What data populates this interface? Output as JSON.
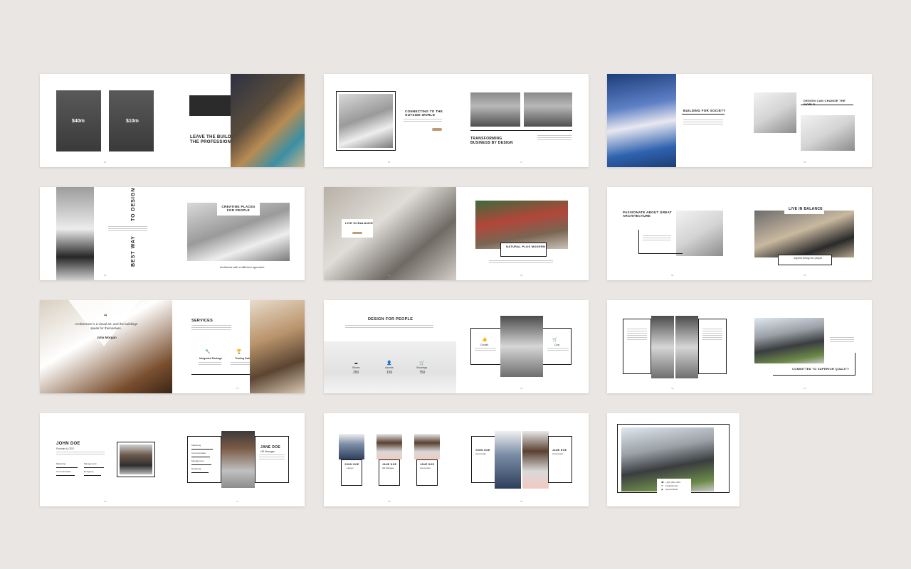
{
  "spreads": [
    {
      "photo_labels": [
        "$40m",
        "$10m"
      ],
      "title": "LEAVE THE BUILDING TO THE PROFESSIONALS."
    },
    {
      "title_left": "CONNECTING TO THE OUTSIDE WORLD",
      "title_right": "TRANSFORMING BUSINESS BY DESIGN"
    },
    {
      "title_left": "BUILDING FOR SOCIETY",
      "title_right": "DESIGN CAN CHANGE THE WORLD"
    },
    {
      "vertical_text_1": "TO DESIGN",
      "vertical_text_2": "BEST WAY",
      "title_right": "CREATING PLACES FOR PEOPLE",
      "caption_right": "Architects with a different approach."
    },
    {
      "title_left": "LIVE IN BALANCE",
      "title_right": "NATURAL PLUS MODERN"
    },
    {
      "title_left": "PASSIONATE ABOUT GREAT ARCHITECTURE",
      "title_right": "LIVE IN BALANCE",
      "caption_right": "Inspired design for people"
    },
    {
      "quote_mark": "“",
      "quote": "Architecture is a visual art, and the buildings speak for themselves.",
      "author": "Julia Morgan",
      "title_right": "SERVICES",
      "service_1": "Integrated Package",
      "service_2": "Trading Gate"
    },
    {
      "title": "DESIGN FOR PEOPLE",
      "stat_labels": [
        "Shows",
        "Awards",
        "Showings"
      ],
      "stat_values": [
        "250",
        "150",
        "750"
      ],
      "right_labels": [
        "Growth",
        "Cost"
      ]
    },
    {
      "title_right": "COMMITTED TO SUPERIOR QUALITY"
    },
    {
      "name_left": "JOHN DOE",
      "role_left": "Founder & CEO",
      "skills_left": [
        "Marketing",
        "Communication",
        "Management",
        "Designing"
      ],
      "name_right": "JANE DOE",
      "role_right": "HR Manager",
      "skills_right": [
        "Marketing",
        "Communication",
        "Management",
        "Designing"
      ]
    },
    {
      "team": [
        {
          "name": "JOHN DOE",
          "role": "Lawyer"
        },
        {
          "name": "JANE DOE",
          "role": "HR Manager"
        },
        {
          "name": "JANE DOE",
          "role": "Accountant"
        }
      ],
      "pair": [
        {
          "name": "JOHN DOE",
          "role": "Accountant"
        },
        {
          "name": "JANE DOE",
          "role": "Accountant"
        }
      ]
    },
    {
      "contact": [
        "+(0)0 (00) 1234",
        "info@domain",
        "www.website"
      ]
    }
  ]
}
